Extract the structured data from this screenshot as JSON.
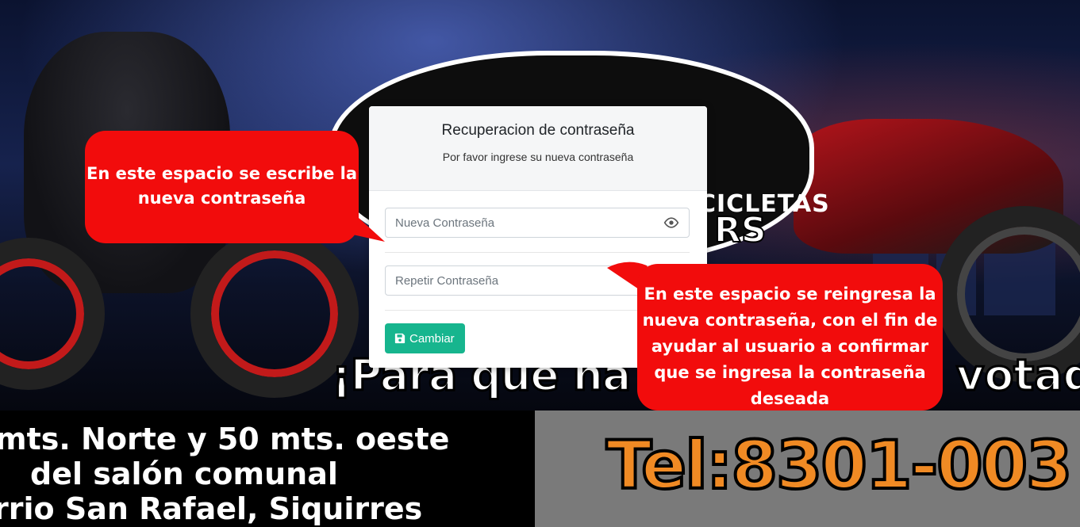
{
  "background": {
    "logo_line1": "CICLETAS",
    "logo_line2": "RS",
    "slogan_left": "¡Para que ha",
    "slogan_right": "votad",
    "address_lines": [
      "mts. Norte y 50 mts. oeste",
      "del salón comunal",
      "rrio San Rafael, Siquirres"
    ],
    "phone": "Tel:8301-003"
  },
  "card": {
    "title": "Recuperacion de contraseña",
    "subtitle": "Por favor ingrese su nueva contraseña",
    "new_password_placeholder": "Nueva Contraseña",
    "repeat_password_placeholder": "Repetir Contraseña",
    "submit_label": "Cambiar"
  },
  "callouts": {
    "new_password": "En este espacio se escribe la nueva contraseña",
    "repeat_password": "En este espacio se reingresa la nueva contraseña, con el fin de ayudar al usuario a confirmar que se ingresa la contraseña deseada"
  },
  "colors": {
    "accent": "#17b58e",
    "callout": "#f20c0c",
    "phone": "#f08a24"
  },
  "icons": {
    "password_toggle": "eye-icon",
    "submit": "save-icon"
  }
}
